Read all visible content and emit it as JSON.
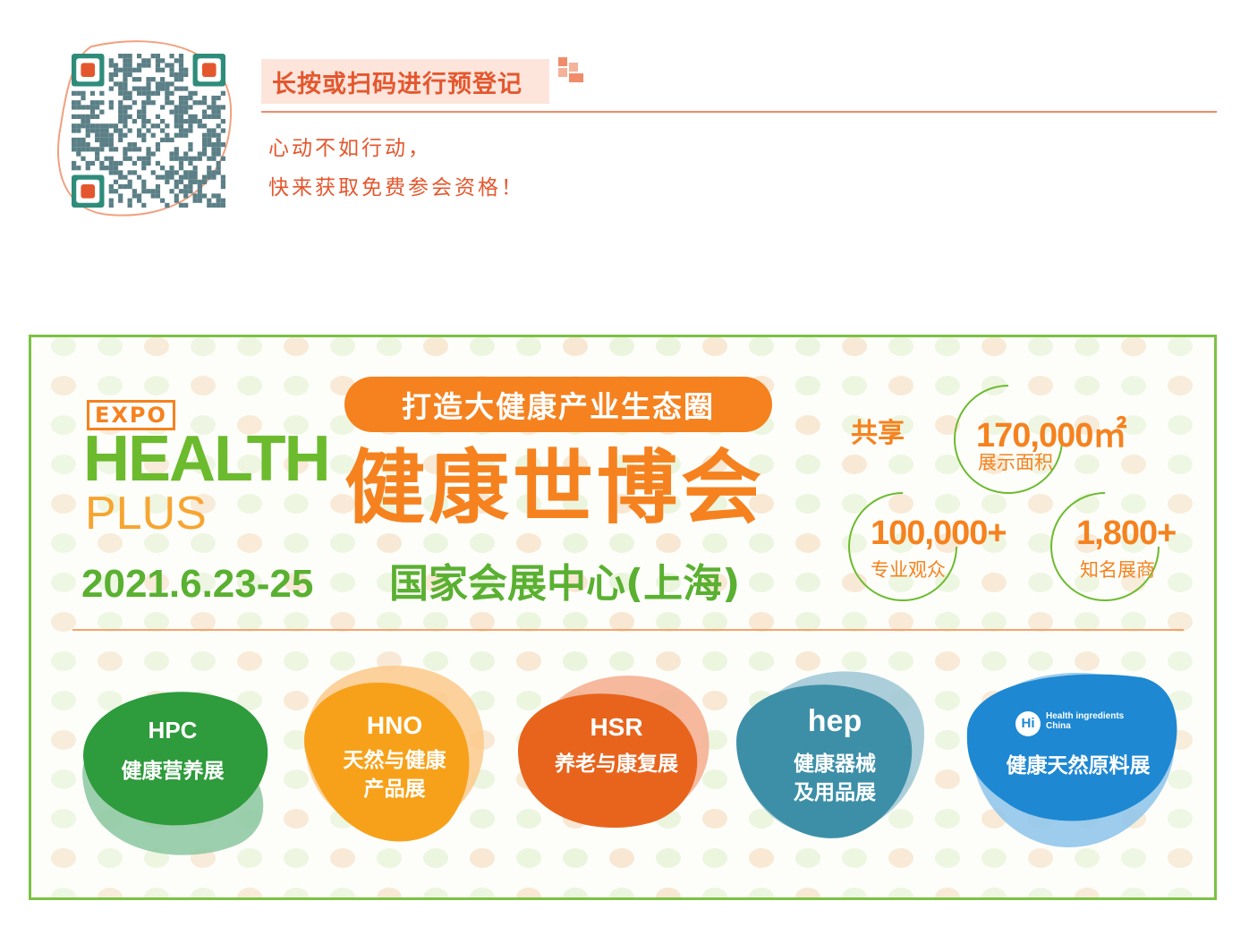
{
  "registration": {
    "title": "长按或扫码进行预登记",
    "line1": "心动不如行动，",
    "line2": "快来获取免费参会资格！"
  },
  "banner": {
    "expo_tag": "EXPO",
    "brand_word1": "HEALTH",
    "brand_word2": "PLUS",
    "slogan": "打造大健康产业生态圈",
    "title": "健康世博会",
    "date": "2021.6.23-25",
    "venue": "国家会展中心(上海)",
    "share_label": "共享",
    "stats": [
      {
        "value": "170,000㎡",
        "label": "展示面积"
      },
      {
        "value": "100,000+",
        "label": "专业观众"
      },
      {
        "value": "1,800+",
        "label": "知名展商"
      }
    ],
    "zones": [
      {
        "logo": "HPC",
        "name": "健康营养展",
        "color": "#2e9b3c",
        "shadow": "#8bc7a0"
      },
      {
        "logo": "HNO",
        "name_line1": "天然与健康",
        "name_line2": "产品展",
        "color": "#f7a11a",
        "shadow": "#fbc98a"
      },
      {
        "logo": "HSR",
        "name": "养老与康复展",
        "color": "#e8641d",
        "shadow": "#f4ad8d"
      },
      {
        "logo": "hep",
        "name_line1": "健康器械",
        "name_line2": "及用品展",
        "color": "#3d8fa8",
        "shadow": "#9cc6d4"
      },
      {
        "logo": "Hi",
        "logo_text": "Health ingredients China",
        "name": "健康天然原料展",
        "color": "#1e88d2",
        "shadow": "#8cc3ea"
      }
    ]
  },
  "colors": {
    "orange": "#f5821f",
    "green": "#6cbb2e",
    "coral": "#e4572e"
  }
}
